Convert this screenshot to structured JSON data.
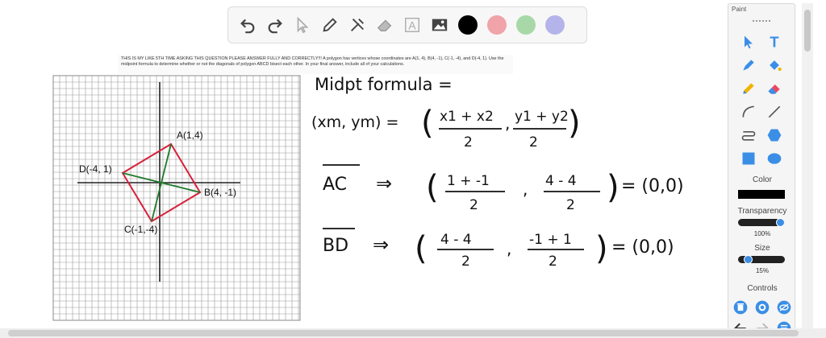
{
  "question_text": "THIS IS MY LIKE 5TH TIME ASKING THIS QUESTION PLEASE ANSWER FULLY AND CORRECTLY!!! A polygon has vertices whose coordinates are A(1, 4), B(4, -1), C(-1, -4), and D(-4, 1). Use the midpoint formula to determine whether or not the diagonals of polygon ABCD bisect each other. In your final answer, include all of your calculations.",
  "graph_labels": {
    "A": "A(1,4)",
    "B": "B(4, -1)",
    "C": "C(-1,-4)",
    "D": "D(-4, 1)"
  },
  "handwriting": {
    "title": "Midpt formula =",
    "formula_lhs": "(xm, ym) =",
    "formula_x_num": "x1 + x2",
    "formula_y_num": "y1 + y2",
    "den": "2",
    "ac_label": "AC",
    "ac_x_num": "1 + -1",
    "ac_y_num": "4 - 4",
    "ac_result": "= (0,0)",
    "bd_label": "BD",
    "bd_x_num": "4 - 4",
    "bd_y_num": "-1 + 1",
    "bd_result": "= (0,0)",
    "arrow": "⇒",
    "comma": ","
  },
  "panel": {
    "title": "Paint",
    "color_label": "Color",
    "transparency_label": "Transparency",
    "transparency_value": "100%",
    "transparency_level": 1.0,
    "size_label": "Size",
    "size_value": "15%",
    "size_level": 0.15,
    "controls_label": "Controls",
    "current_color": "#000000"
  },
  "toolbar": {
    "swatches": [
      "#000000",
      "#f0a3a8",
      "#a8d8a8",
      "#b4b4ea"
    ]
  },
  "colors": {
    "quad": "#d8203a",
    "diag": "#1f7a2a",
    "accent": "#3a8ee6"
  }
}
